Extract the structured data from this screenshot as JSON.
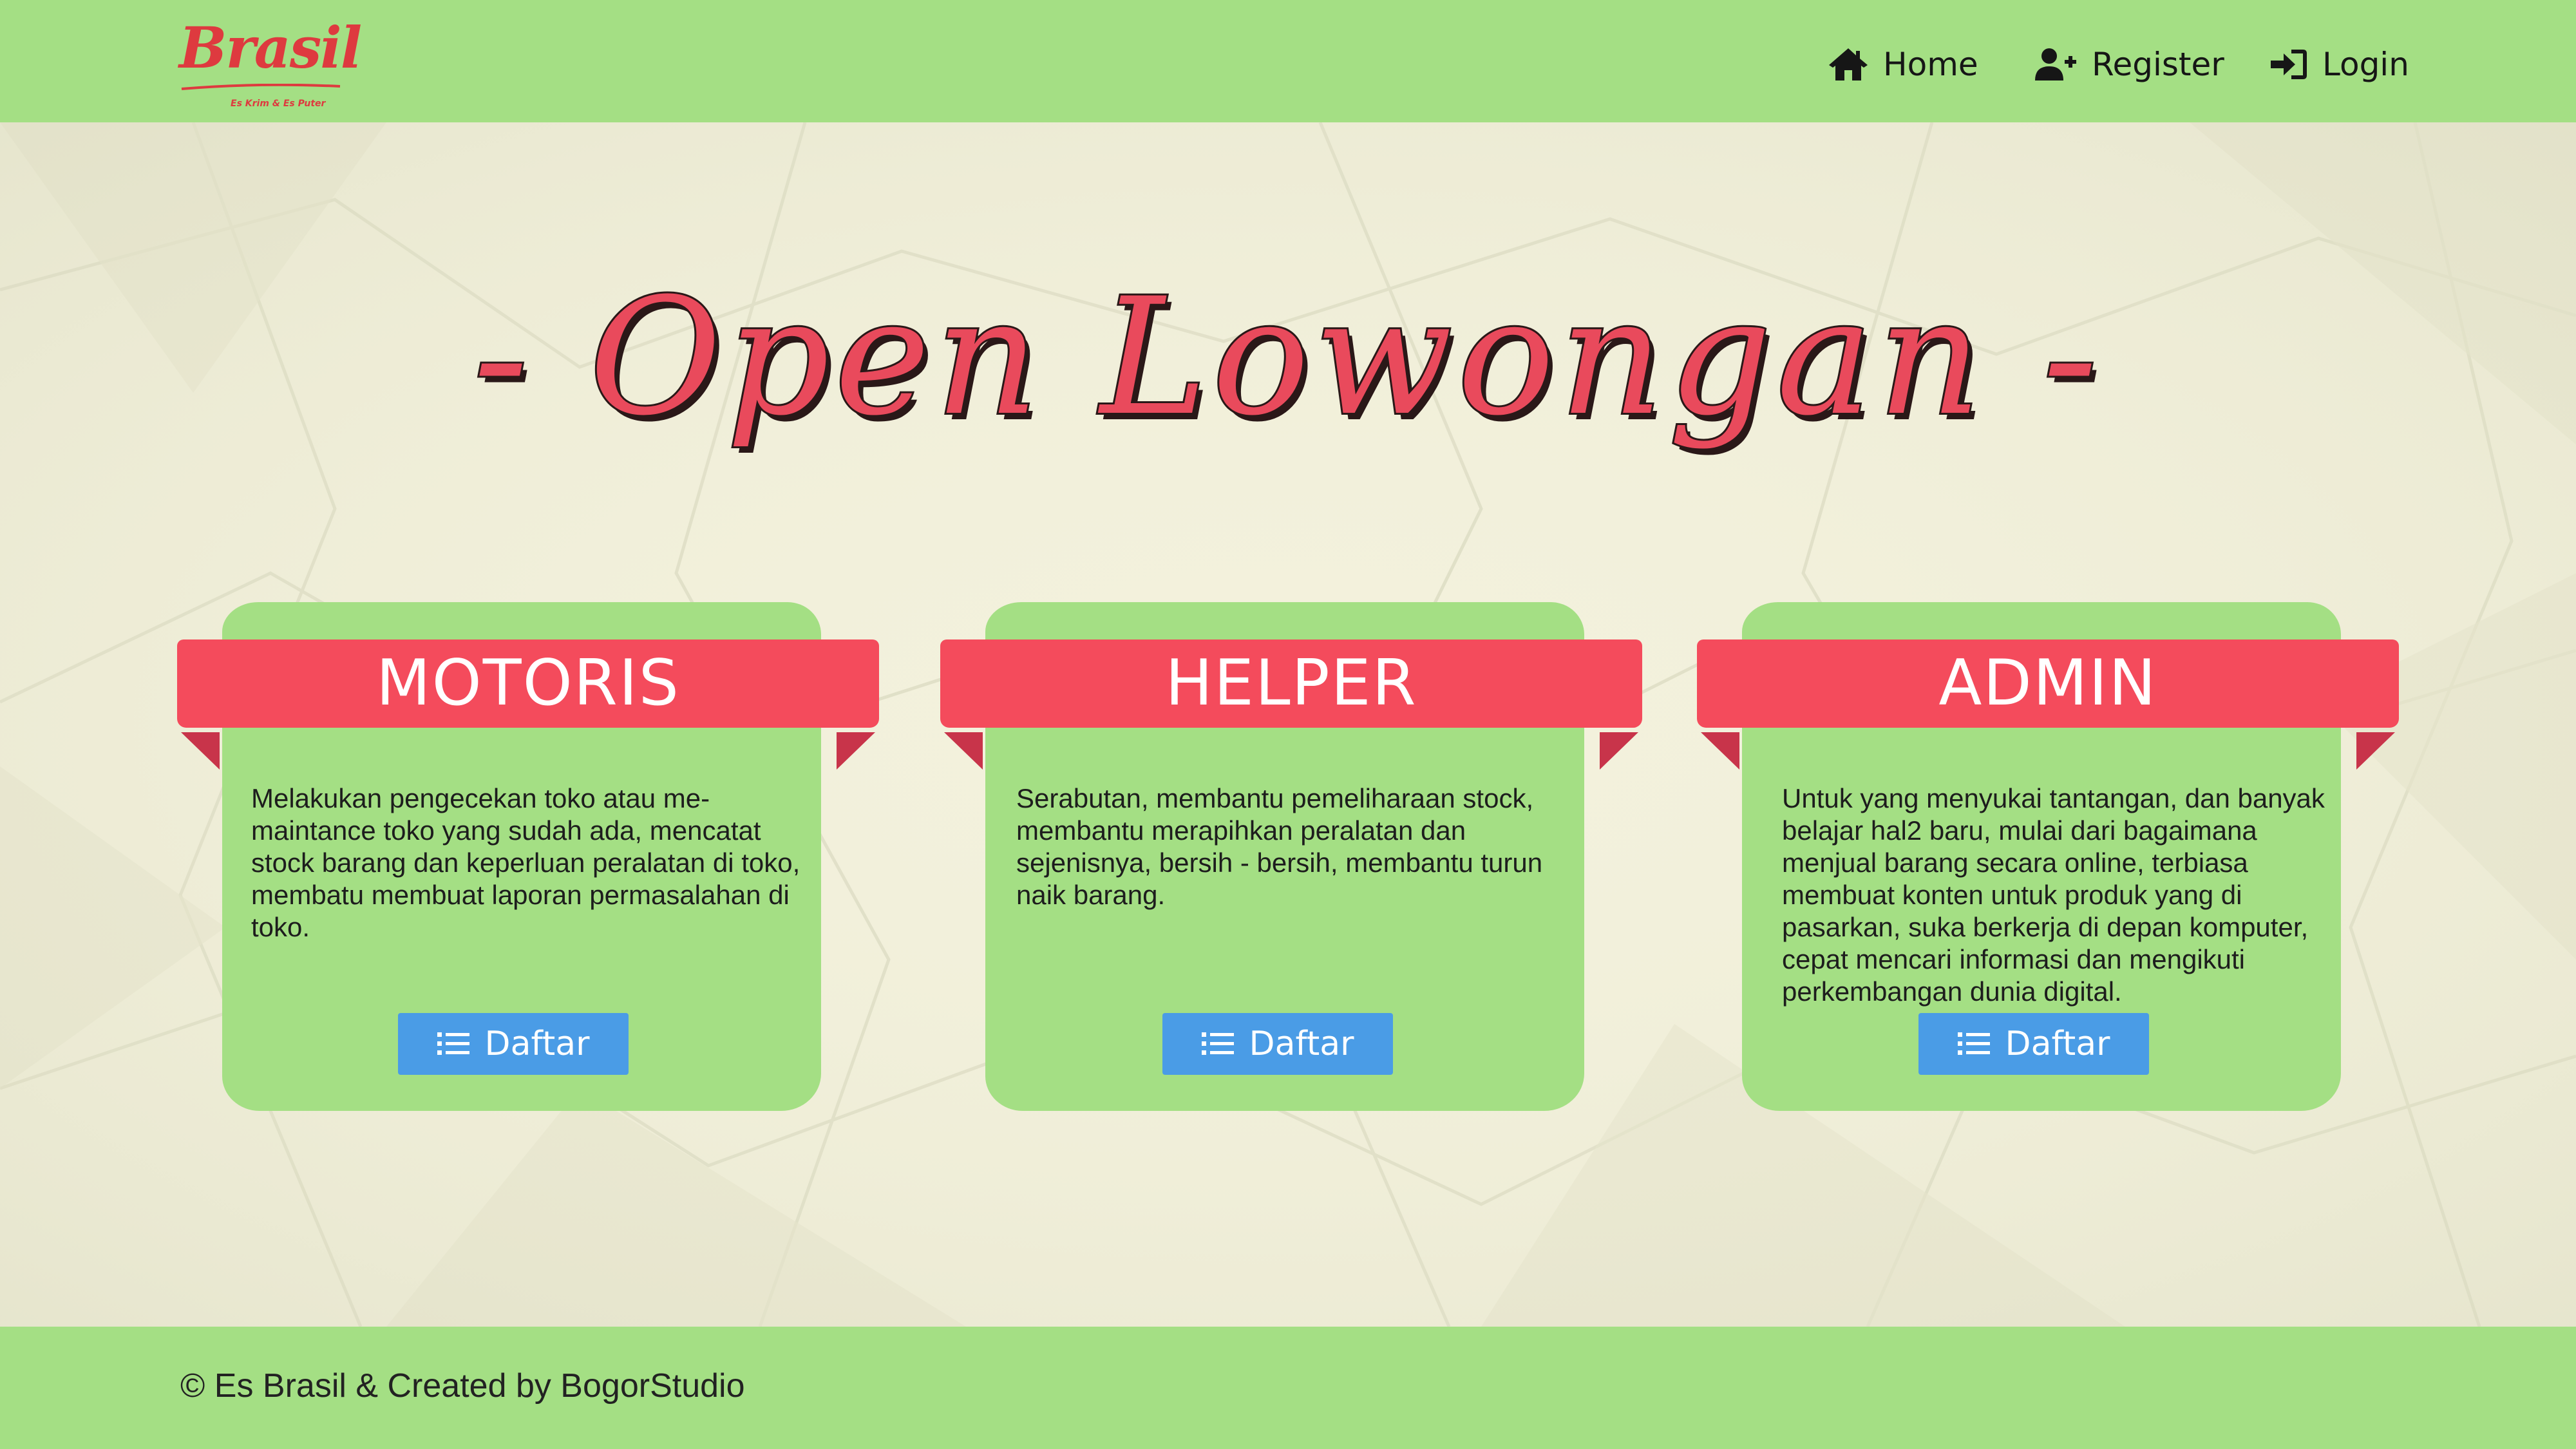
{
  "brand": {
    "name": "Brasil",
    "tagline": "Es Krim & Es Puter",
    "color": "#de3a3f"
  },
  "nav": {
    "items": [
      {
        "label": "Home",
        "icon": "home-icon"
      },
      {
        "label": "Register",
        "icon": "user-plus-icon"
      },
      {
        "label": "Login",
        "icon": "sign-in-icon"
      }
    ]
  },
  "hero": {
    "title": "- Open Lowongan -"
  },
  "jobs": [
    {
      "title": "MOTORIS",
      "description": "Melakukan pengecekan toko atau me-maintance toko yang sudah ada, mencatat stock barang dan keperluan peralatan di toko, membatu membuat laporan permasalahan di toko.",
      "button": "Daftar"
    },
    {
      "title": "HELPER",
      "description": "Serabutan, membantu pemeliharaan stock, membantu merapihkan peralatan dan sejenisnya, bersih - bersih, membantu turun naik barang.",
      "button": "Daftar"
    },
    {
      "title": "ADMIN",
      "description": "Untuk yang menyukai tantangan, dan banyak belajar hal2 baru, mulai dari bagaimana menjual barang secara online, terbiasa membuat konten untuk produk yang di pasarkan, suka berkerja di depan komputer, cepat mencari informasi dan mengikuti perkembangan dunia digital.",
      "button": "Daftar"
    }
  ],
  "footer": {
    "text": "© Es Brasil & Created by BogorStudio"
  },
  "colors": {
    "nav_bg": "#a4df84",
    "card_bg": "#a4df84",
    "ribbon": "#f44b5c",
    "ribbon_shadow": "#c8344a",
    "button": "#4a9ce6",
    "page_bg": "#f4f2dc",
    "heading": "#e94a5c"
  }
}
